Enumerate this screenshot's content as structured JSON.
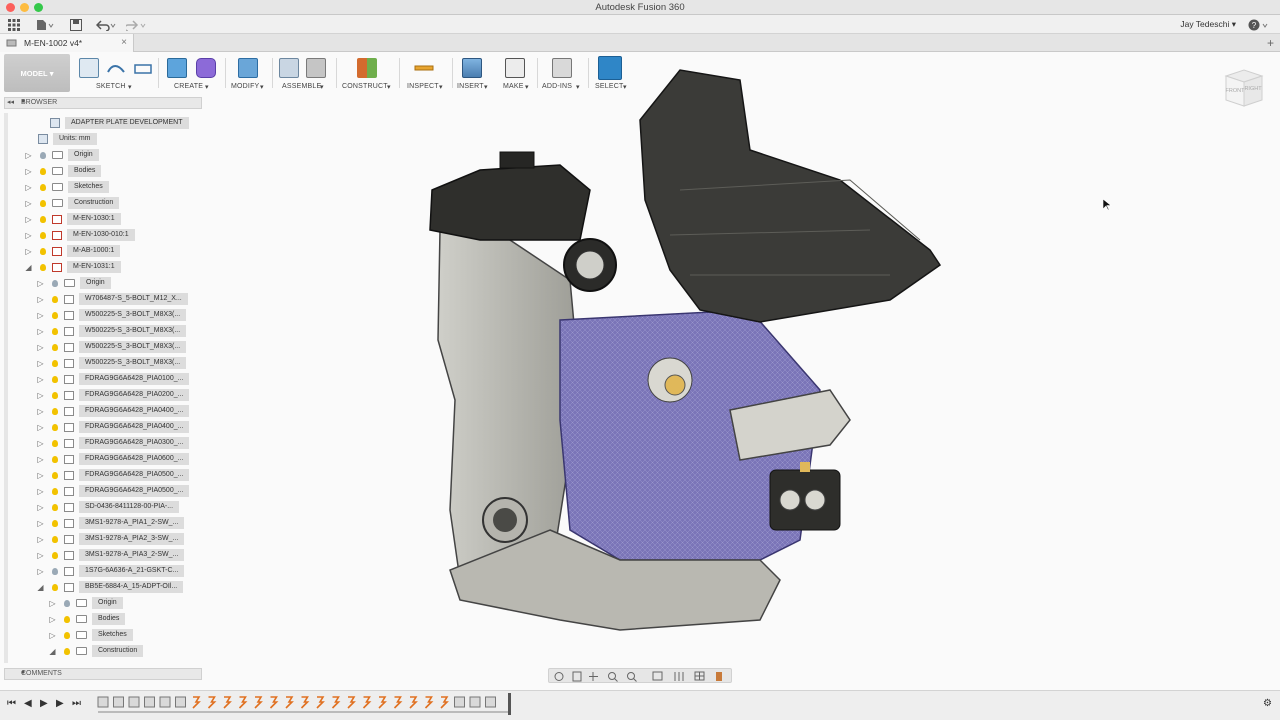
{
  "window": {
    "title": "Autodesk Fusion 360"
  },
  "appbar": {
    "user": "Jay Tedeschi",
    "help_label": "?"
  },
  "tab": {
    "label": "M-EN-1002 v4*",
    "close": "×"
  },
  "toolbar": {
    "workspace": "MODEL",
    "groups": [
      {
        "label": "SKETCH"
      },
      {
        "label": "CREATE"
      },
      {
        "label": "MODIFY"
      },
      {
        "label": "ASSEMBLE"
      },
      {
        "label": "CONSTRUCT"
      },
      {
        "label": "INSPECT"
      },
      {
        "label": "INSERT"
      },
      {
        "label": "MAKE"
      },
      {
        "label": "ADD-INS"
      },
      {
        "label": "SELECT"
      }
    ]
  },
  "viewcube": {
    "front": "FRONT",
    "right": "RIGHT"
  },
  "browser": {
    "title": "BROWSER",
    "rows": [
      {
        "label": "ADAPTER PLATE DEVELOPMENT",
        "icon": "document-icon"
      },
      {
        "label": "Units: mm",
        "icon": "units-icon"
      },
      {
        "label": "Origin",
        "icon": "folder-icon"
      },
      {
        "label": "Bodies",
        "icon": "folder-icon"
      },
      {
        "label": "Sketches",
        "icon": "folder-icon"
      },
      {
        "label": "Construction",
        "icon": "folder-icon"
      },
      {
        "label": "M-EN-1030:1",
        "icon": "linked-component-icon"
      },
      {
        "label": "M-EN-1030-010:1",
        "icon": "linked-component-icon"
      },
      {
        "label": "M-AB-1000:1",
        "icon": "linked-component-icon"
      },
      {
        "label": "M-EN-1031:1",
        "icon": "linked-component-icon"
      },
      {
        "label": "Origin",
        "icon": "folder-icon"
      },
      {
        "label": "W706487-S_5-BOLT_M12_X...",
        "icon": "component-icon"
      },
      {
        "label": "W500225-S_3-BOLT_M8X3(...",
        "icon": "component-icon"
      },
      {
        "label": "W500225-S_3-BOLT_M8X3(...",
        "icon": "component-icon"
      },
      {
        "label": "W500225-S_3-BOLT_M8X3(...",
        "icon": "component-icon"
      },
      {
        "label": "W500225-S_3-BOLT_M8X3(...",
        "icon": "component-icon"
      },
      {
        "label": "FDRAG9G6A6428_PIA0100_...",
        "icon": "component-icon"
      },
      {
        "label": "FDRAG9G6A6428_PIA0200_...",
        "icon": "component-icon"
      },
      {
        "label": "FDRAG9G6A6428_PIA0400_...",
        "icon": "component-icon"
      },
      {
        "label": "FDRAG9G6A6428_PIA0400_...",
        "icon": "component-icon"
      },
      {
        "label": "FDRAG9G6A6428_PIA0300_...",
        "icon": "component-icon"
      },
      {
        "label": "FDRAG9G6A6428_PIA0600_...",
        "icon": "component-icon"
      },
      {
        "label": "FDRAG9G6A6428_PIA0500_...",
        "icon": "component-icon"
      },
      {
        "label": "FDRAG9G6A6428_PIA0500_...",
        "icon": "component-icon"
      },
      {
        "label": "SD-0436-8411128-00-PIA-...",
        "icon": "component-icon"
      },
      {
        "label": "3MS1-9278-A_PIA1_2-SW_...",
        "icon": "component-icon"
      },
      {
        "label": "3MS1-9278-A_PIA2_3-SW_...",
        "icon": "component-icon"
      },
      {
        "label": "3MS1-9278-A_PIA3_2-SW_...",
        "icon": "component-icon"
      },
      {
        "label": "1S7G-6A636-A_21-GSKT-C...",
        "icon": "component-icon"
      },
      {
        "label": "BB5E-6884-A_15-ADPT-OIl...",
        "icon": "component-icon"
      },
      {
        "label": "Origin",
        "icon": "folder-icon"
      },
      {
        "label": "Bodies",
        "icon": "folder-icon"
      },
      {
        "label": "Sketches",
        "icon": "folder-icon"
      },
      {
        "label": "Construction",
        "icon": "folder-icon"
      }
    ]
  },
  "comments": {
    "title": "COMMENTS"
  },
  "colors": {
    "accent": "#2f86c7",
    "engine_block": "#7b75b8",
    "engine_dark": "#3b3b38"
  }
}
